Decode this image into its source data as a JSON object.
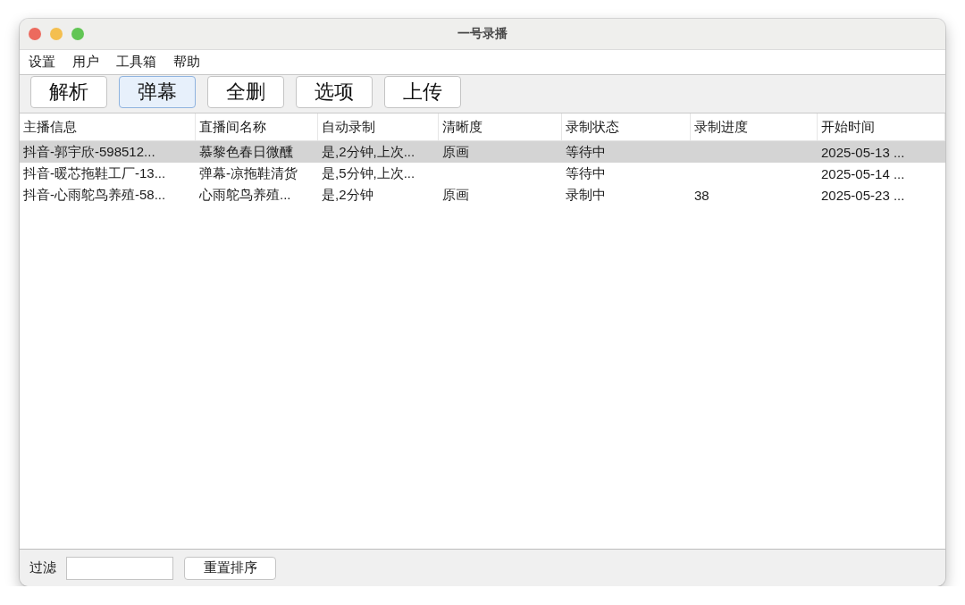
{
  "window": {
    "title": "一号录播"
  },
  "menu_bar": [
    "设置",
    "用户",
    "工具箱",
    "帮助"
  ],
  "toolbar": [
    {
      "label": "解析",
      "focused": false
    },
    {
      "label": "弹幕",
      "focused": true
    },
    {
      "label": "全删",
      "focused": false
    },
    {
      "label": "选项",
      "focused": false
    },
    {
      "label": "上传",
      "focused": false
    }
  ],
  "table": {
    "columns": [
      "主播信息",
      "直播间名称",
      "自动录制",
      "清晰度",
      "录制状态",
      "录制进度",
      "开始时间"
    ],
    "rows": [
      {
        "selected": true,
        "cells": [
          "抖音-郭宇欣-598512...",
          "慕黎色春日微醺",
          "是,2分钟,上次...",
          "原画",
          "等待中",
          null,
          "2025-05-13 ..."
        ]
      },
      {
        "selected": false,
        "cells": [
          "抖音-暖芯拖鞋工厂-13...",
          "弹幕-凉拖鞋清货",
          "是,5分钟,上次...",
          null,
          "等待中",
          null,
          "2025-05-14 ..."
        ]
      },
      {
        "selected": false,
        "cells": [
          "抖音-心雨鸵鸟养殖-58...",
          "心雨鸵鸟养殖...",
          "是,2分钟",
          "原画",
          "录制中",
          "38",
          "2025-05-23 ..."
        ]
      }
    ]
  },
  "filter_bar": {
    "label": "过滤",
    "reset_button": "重置排序"
  }
}
